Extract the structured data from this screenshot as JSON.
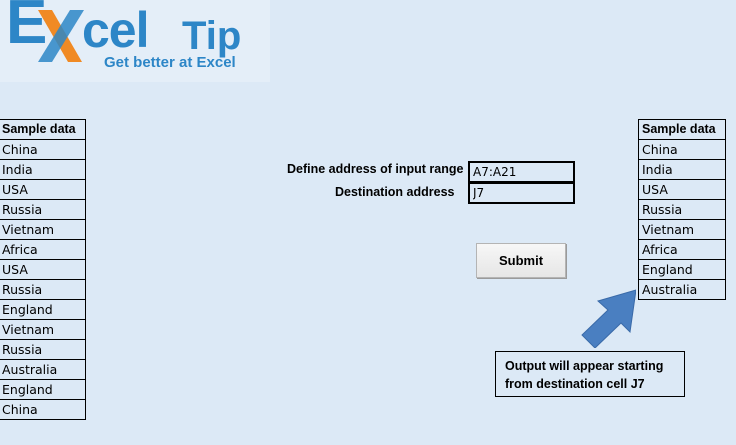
{
  "logo": {
    "first_letter": "E",
    "word_rest": "cel",
    "tip": "Tip",
    "tagline": "Get better at Excel",
    "brand_color": "#2d86c7",
    "accent_color": "#f08a24"
  },
  "left_table": {
    "header": "Sample data",
    "rows": [
      "China",
      "India",
      "USA",
      "Russia",
      "Vietnam",
      "Africa",
      "USA",
      "Russia",
      "England",
      "Vietnam",
      "Russia",
      "Australia",
      "England",
      "China"
    ]
  },
  "form": {
    "input_range_label": "Define address of input range",
    "input_range_value": "A7:A21",
    "destination_label": "Destination address",
    "destination_value": "J7",
    "submit_label": "Submit"
  },
  "right_table": {
    "header": "Sample data",
    "rows": [
      "China",
      "India",
      "USA",
      "Russia",
      "Vietnam",
      "Africa",
      "England",
      "Australia"
    ]
  },
  "note": {
    "text": "Output will appear starting\nfrom destination cell J7"
  },
  "colors": {
    "background": "#dce9f6",
    "arrow": "#4a7fc1"
  }
}
